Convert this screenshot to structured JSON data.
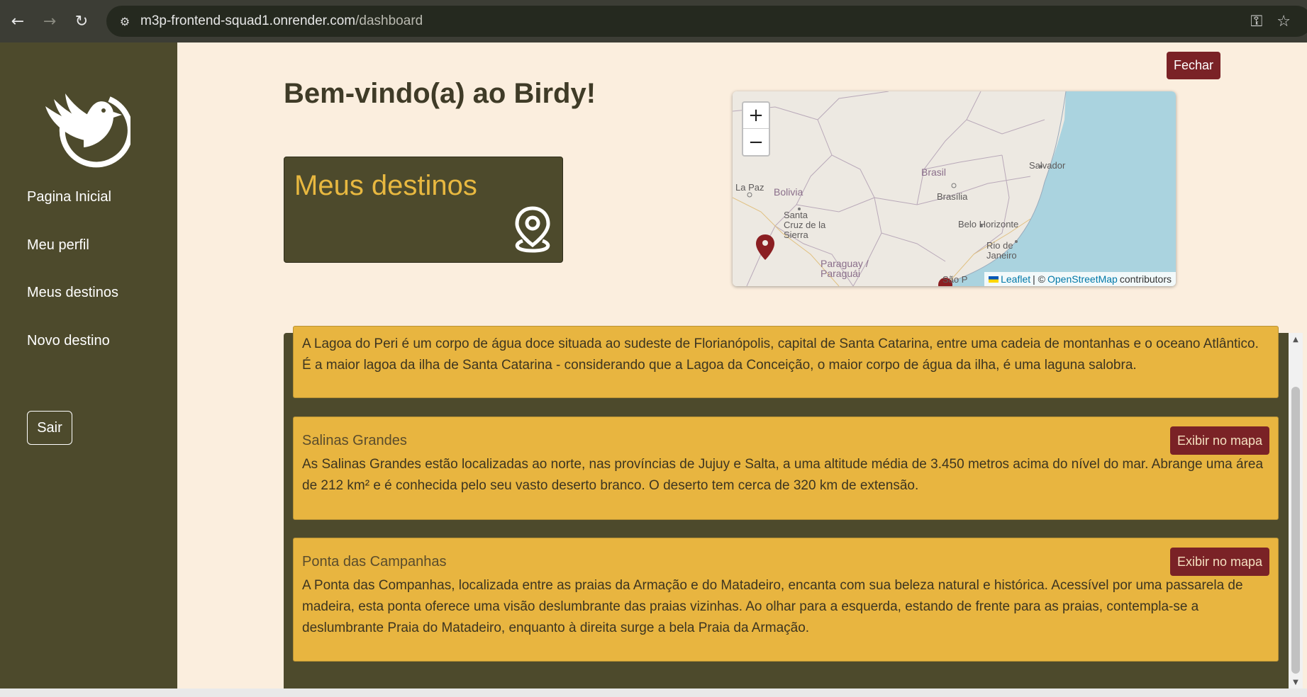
{
  "browser": {
    "url_host": "m3p-frontend-squad1.onrender.com",
    "url_path": "/dashboard"
  },
  "sidebar": {
    "items": [
      {
        "label": "Pagina Inicial"
      },
      {
        "label": "Meu perfil"
      },
      {
        "label": "Meus destinos"
      },
      {
        "label": "Novo destino"
      }
    ],
    "logout_label": "Sair"
  },
  "header": {
    "close_label": "Fechar",
    "title": "Bem-vindo(a) ao Birdy!"
  },
  "card": {
    "label": "Meus destinos"
  },
  "map": {
    "zoom_in": "+",
    "zoom_out": "−",
    "labels": {
      "la_paz": "La Paz",
      "bolivia": "Bolivia",
      "brasil": "Brasil",
      "brasilia": "Brasília",
      "salvador": "Salvador",
      "santa_cruz": "Santa Cruz de la Sierra",
      "belo_horizonte": "Belo Horizonte",
      "rio": "Rio de Janeiro",
      "paraguay": "Paraguay / Paraguái",
      "sao_paulo": "São P"
    },
    "attribution": {
      "leaflet": "Leaflet",
      "separator": "| ©",
      "osm": "OpenStreetMap",
      "contributors": "contributors"
    }
  },
  "destinations": {
    "items": [
      {
        "name": "",
        "description": "A Lagoa do Peri é um corpo de água doce situada ao sudeste de Florianópolis, capital de Santa Catarina, entre uma cadeia de montanhas e o oceano Atlântico. É a maior lagoa da ilha de Santa Catarina - considerando que a Lagoa da Conceição, o maior corpo de água da ilha, é uma laguna salobra."
      },
      {
        "name": "Salinas Grandes",
        "button": "Exibir no mapa",
        "description": "As Salinas Grandes estão localizadas ao norte, nas províncias de Jujuy e Salta, a uma altitude média de 3.450 metros acima do nível do mar. Abrange uma área de 212 km² e é conhecida pelo seu vasto deserto branco. O deserto tem cerca de 320 km de extensão."
      },
      {
        "name": "Ponta das Campanhas",
        "button": "Exibir no mapa",
        "description": "A Ponta das Companhas, localizada entre as praias da Armação e do Matadeiro, encanta com sua beleza natural e histórica. Acessível por uma passarela de madeira, esta ponta oferece uma visão deslumbrante das praias vizinhas. Ao olhar para a esquerda, estando de frente para as praias, contempla-se a deslumbrante Praia do Matadeiro, enquanto à direita surge a bela Praia da Armação."
      }
    ]
  },
  "colors": {
    "sidebar": "#4d4a2c",
    "accent": "#e8b540",
    "button": "#7a2226",
    "background": "#fbeede"
  }
}
